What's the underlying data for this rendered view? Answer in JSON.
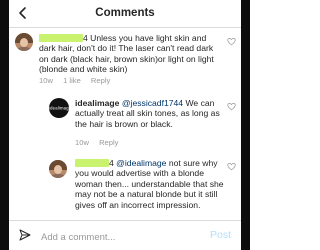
{
  "header": {
    "title": "Comments",
    "back_icon": "chevron-left-icon"
  },
  "comments": [
    {
      "username_hidden": true,
      "text": "4 Unless you have light skin and dark hair, don't do it! The laser can't read dark on dark (black hair, brown skin)or light on light (blonde and white skin)",
      "time": "10w",
      "likes": "1 like",
      "reply": "Reply"
    },
    {
      "username": "idealimage",
      "avatar_text": "idealimage",
      "mention": "@jessicadf1744",
      "text": " We can actually treat all skin tones, as long as the hair is brown or black.",
      "time": "10w",
      "reply": "Reply"
    },
    {
      "username_hidden": true,
      "text_lead": "4",
      "mention": "@idealimage",
      "text": " not sure why you would advertise with a blonde woman then... understandable that she may not be a natural blonde but it still gives off an incorrect impression."
    }
  ],
  "composer": {
    "placeholder": "Add a comment...",
    "post_label": "Post",
    "share_icon": "send-icon"
  },
  "colors": {
    "redaction": "#c9f26e",
    "mention": "#003569",
    "post_disabled": "#b2dffc",
    "meta_gray": "#999999"
  }
}
